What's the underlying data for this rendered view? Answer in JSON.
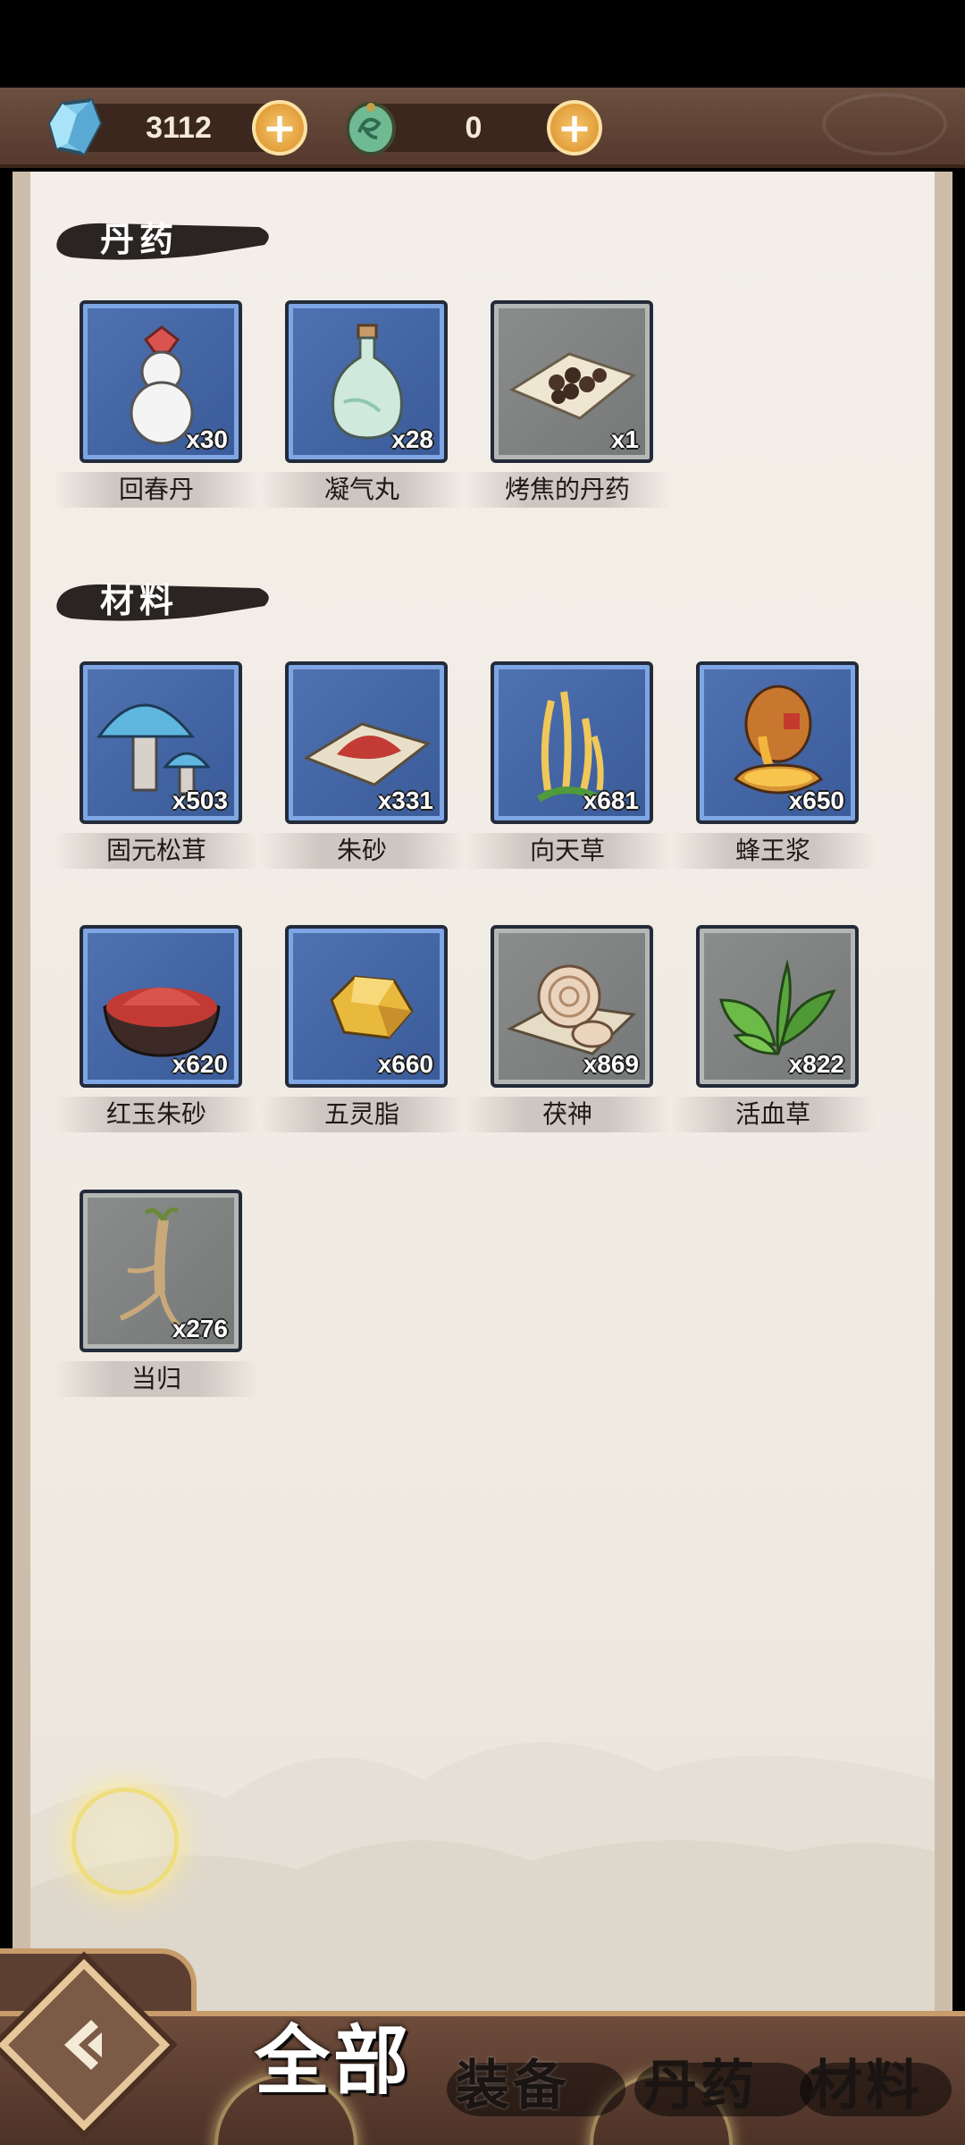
{
  "currencies": [
    {
      "icon": "spirit-stone-icon",
      "amount": "3112"
    },
    {
      "icon": "jade-token-icon",
      "amount": "0"
    }
  ],
  "sections": [
    {
      "title": "丹药",
      "items": [
        {
          "name": "回春丹",
          "count": "x30",
          "rarity": "blue",
          "icon": "gourd-pill-icon"
        },
        {
          "name": "凝气丸",
          "count": "x28",
          "rarity": "blue",
          "icon": "porcelain-vase-icon"
        },
        {
          "name": "烤焦的丹药",
          "count": "x1",
          "rarity": "gray",
          "icon": "burnt-pills-icon"
        }
      ]
    },
    {
      "title": "材料",
      "items": [
        {
          "name": "固元松茸",
          "count": "x503",
          "rarity": "blue",
          "icon": "mushroom-icon"
        },
        {
          "name": "朱砂",
          "count": "x331",
          "rarity": "blue",
          "icon": "cinnabar-powder-icon"
        },
        {
          "name": "向天草",
          "count": "x681",
          "rarity": "blue",
          "icon": "golden-grass-icon"
        },
        {
          "name": "蜂王浆",
          "count": "x650",
          "rarity": "blue",
          "icon": "honey-jar-icon"
        },
        {
          "name": "红玉朱砂",
          "count": "x620",
          "rarity": "blue",
          "icon": "red-powder-bowl-icon"
        },
        {
          "name": "五灵脂",
          "count": "x660",
          "rarity": "blue",
          "icon": "amber-crystal-icon"
        },
        {
          "name": "茯神",
          "count": "x869",
          "rarity": "gray",
          "icon": "fungus-slices-icon"
        },
        {
          "name": "活血草",
          "count": "x822",
          "rarity": "gray",
          "icon": "green-leaf-icon"
        },
        {
          "name": "当归",
          "count": "x276",
          "rarity": "gray",
          "icon": "root-icon"
        }
      ]
    }
  ],
  "bottom_nav": {
    "tabs": [
      "全部",
      "装备",
      "丹药",
      "材料"
    ],
    "active": "全部"
  }
}
